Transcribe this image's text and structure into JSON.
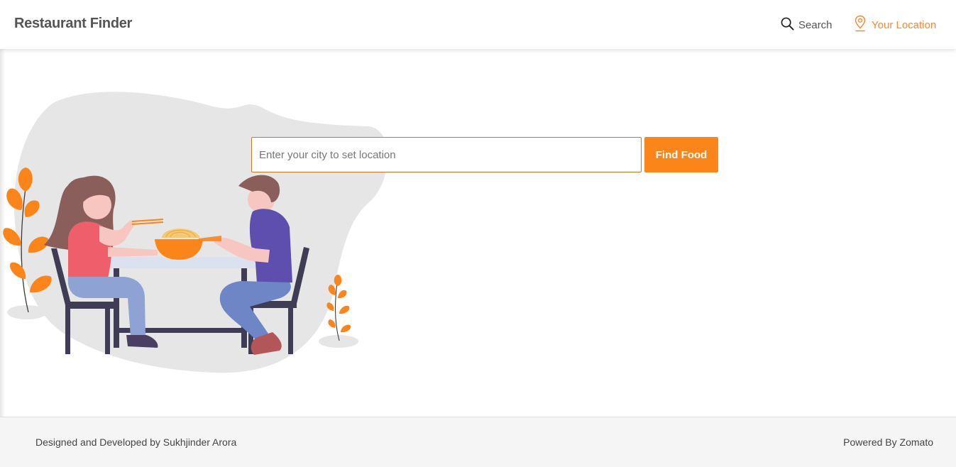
{
  "header": {
    "brand": "Restaurant Finder",
    "search_label": "Search",
    "location_label": "Your Location",
    "search_icon": "search-icon",
    "location_icon": "map-pin-icon"
  },
  "main": {
    "city_input": {
      "placeholder": "Enter your city to set location",
      "value": ""
    },
    "find_button_label": "Find Food",
    "illustration": "couple-eating-noodles-illustration"
  },
  "footer": {
    "credit": "Designed and Developed by Sukhjinder Arora",
    "powered_by": "Powered By Zomato"
  },
  "colors": {
    "accent": "#fb8519",
    "brand_text": "#555555",
    "footer_bg": "#f5f5f5"
  }
}
